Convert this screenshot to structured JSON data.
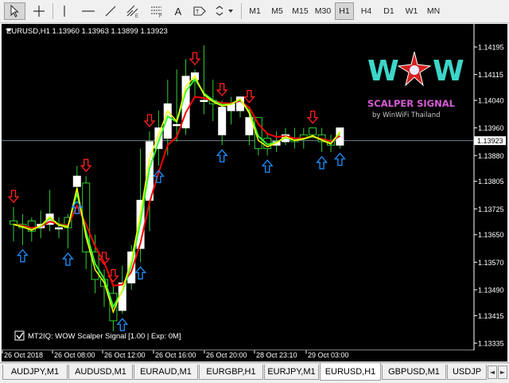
{
  "toolbar": {
    "tools": [
      "cursor-icon",
      "crosshair-icon",
      "vertical-line-icon",
      "horizontal-line-icon",
      "trendline-icon",
      "equidistant-channel-icon",
      "fibonacci-icon",
      "text-icon",
      "label-icon",
      "shapes-icon"
    ],
    "text_tool": "A",
    "timeframes": [
      "M1",
      "M5",
      "M15",
      "M30",
      "H1",
      "H4",
      "D1",
      "W1",
      "MN"
    ],
    "active_timeframe": "H1"
  },
  "chart": {
    "symbol_header": "EURUSD,H1  1.13960 1.13963 1.13899 1.13923",
    "current_price": "1.13923",
    "price_labels": [
      "1.14195",
      "1.14115",
      "1.14040",
      "1.13960",
      "1.13880",
      "1.13805",
      "1.13725",
      "1.13650",
      "1.13570",
      "1.13490",
      "1.13415",
      "1.13335"
    ],
    "time_labels": [
      "26 Oct 2018",
      "26 Oct 08:00",
      "26 Oct 12:00",
      "26 Oct 16:00",
      "26 Oct 20:00",
      "28 Oct 23:10",
      "29 Oct 03:00"
    ],
    "indicator_label": "MT2IQ: WOW Scalper Signal [1.00 | Exp: 0M]",
    "logo": {
      "letters": [
        "W",
        "W"
      ],
      "title": "SCALPER SIGNAL",
      "subtitle": "by WinWiFi Thailand"
    },
    "colors": {
      "background": "#000000",
      "bull_candle": "#ffffff",
      "wick": "#32cd32",
      "ma_fast": "#ffff00",
      "ma_green": "#32ff32",
      "ma_slow": "#ff0000",
      "up_arrow": "#1e90ff",
      "down_arrow": "#ff2020"
    }
  },
  "tabs": {
    "items": [
      "AUDJPY,M1",
      "AUDUSD,M1",
      "EURAUD,M1",
      "EURGBP,H1",
      "EURJPY,M1",
      "EURUSD,H1",
      "GBPUSD,M1",
      "USDJP"
    ],
    "active": "EURUSD,H1",
    "nav_left": "◄",
    "nav_right": "►"
  },
  "chart_data": {
    "type": "candlestick",
    "symbol": "EURUSD",
    "timeframe": "H1",
    "last_price": 1.13923,
    "candles": [
      {
        "o": 1.1369,
        "c": 1.1368,
        "h": 1.1373,
        "l": 1.1363
      },
      {
        "o": 1.1368,
        "c": 1.1367,
        "h": 1.1371,
        "l": 1.1362
      },
      {
        "o": 1.1369,
        "c": 1.1366,
        "h": 1.137,
        "l": 1.1363
      },
      {
        "o": 1.1367,
        "c": 1.1368,
        "h": 1.1372,
        "l": 1.1364
      },
      {
        "o": 1.1368,
        "c": 1.1371,
        "h": 1.1378,
        "l": 1.1366
      },
      {
        "o": 1.1367,
        "c": 1.1367,
        "h": 1.137,
        "l": 1.1364
      },
      {
        "o": 1.137,
        "c": 1.1367,
        "h": 1.1371,
        "l": 1.1361
      },
      {
        "o": 1.1379,
        "c": 1.1382,
        "h": 1.1385,
        "l": 1.1376
      },
      {
        "o": 1.138,
        "c": 1.136,
        "h": 1.1382,
        "l": 1.1355
      },
      {
        "o": 1.136,
        "c": 1.1352,
        "h": 1.1365,
        "l": 1.1348
      },
      {
        "o": 1.1352,
        "c": 1.135,
        "h": 1.1355,
        "l": 1.1344
      },
      {
        "o": 1.1348,
        "c": 1.134,
        "h": 1.135,
        "l": 1.1337
      },
      {
        "o": 1.1343,
        "c": 1.1351,
        "h": 1.1356,
        "l": 1.1342
      },
      {
        "o": 1.1351,
        "c": 1.136,
        "h": 1.1362,
        "l": 1.1349
      },
      {
        "o": 1.1361,
        "c": 1.1375,
        "h": 1.139,
        "l": 1.1357
      },
      {
        "o": 1.1375,
        "c": 1.1392,
        "h": 1.1395,
        "l": 1.1366
      },
      {
        "o": 1.139,
        "c": 1.1396,
        "h": 1.1401,
        "l": 1.1385
      },
      {
        "o": 1.1393,
        "c": 1.1403,
        "h": 1.141,
        "l": 1.1388
      },
      {
        "o": 1.1397,
        "c": 1.1397,
        "h": 1.1413,
        "l": 1.1392
      },
      {
        "o": 1.1396,
        "c": 1.1411,
        "h": 1.1416,
        "l": 1.1394
      },
      {
        "o": 1.141,
        "c": 1.1412,
        "h": 1.1413,
        "l": 1.1405
      },
      {
        "o": 1.1404,
        "c": 1.1404,
        "h": 1.142,
        "l": 1.14
      },
      {
        "o": 1.1404,
        "c": 1.1403,
        "h": 1.141,
        "l": 1.1398
      },
      {
        "o": 1.1394,
        "c": 1.1402,
        "h": 1.1404,
        "l": 1.1391
      },
      {
        "o": 1.1401,
        "c": 1.1403,
        "h": 1.1405,
        "l": 1.1397
      },
      {
        "o": 1.1401,
        "c": 1.1405,
        "h": 1.1404,
        "l": 1.1399
      },
      {
        "o": 1.1394,
        "c": 1.1399,
        "h": 1.1402,
        "l": 1.1391
      },
      {
        "o": 1.1399,
        "c": 1.139,
        "h": 1.1399,
        "l": 1.1388
      },
      {
        "o": 1.1393,
        "c": 1.139,
        "h": 1.1394,
        "l": 1.1388
      },
      {
        "o": 1.1391,
        "c": 1.1392,
        "h": 1.1395,
        "l": 1.1389
      },
      {
        "o": 1.1392,
        "c": 1.1394,
        "h": 1.1396,
        "l": 1.1391
      },
      {
        "o": 1.1393,
        "c": 1.1392,
        "h": 1.1396,
        "l": 1.139
      },
      {
        "o": 1.1394,
        "c": 1.1393,
        "h": 1.1396,
        "l": 1.139
      },
      {
        "o": 1.1396,
        "c": 1.1394,
        "h": 1.1396,
        "l": 1.1393
      },
      {
        "o": 1.1394,
        "c": 1.1392,
        "h": 1.1396,
        "l": 1.1389
      },
      {
        "o": 1.1392,
        "c": 1.1391,
        "h": 1.1394,
        "l": 1.1389
      },
      {
        "o": 1.1391,
        "c": 1.1396,
        "h": 1.1396,
        "l": 1.139
      }
    ],
    "up_arrows": [
      1,
      6,
      7,
      12,
      14,
      16,
      23,
      28,
      34,
      36
    ],
    "down_arrows": [
      0,
      8,
      10,
      11,
      15,
      20,
      23,
      26,
      33
    ]
  }
}
